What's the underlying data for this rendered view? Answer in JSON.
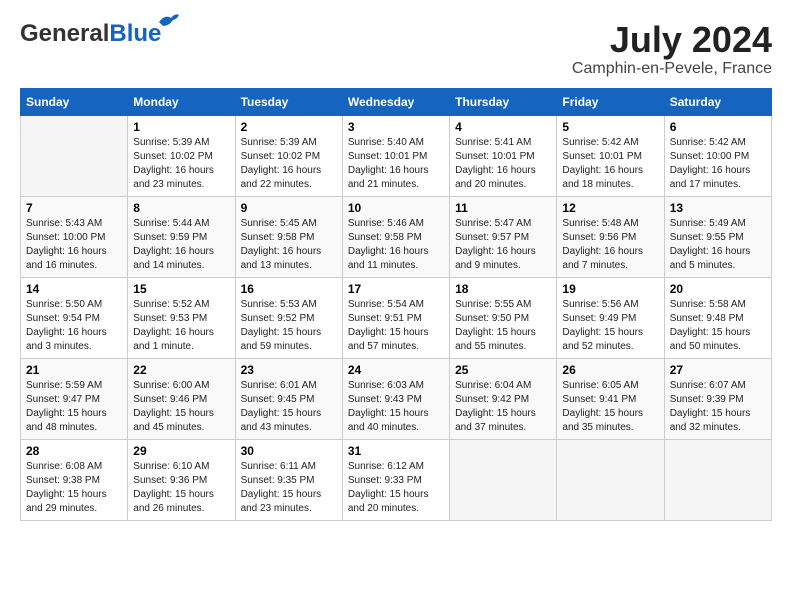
{
  "logo": {
    "general": "General",
    "blue": "Blue"
  },
  "title": {
    "month_year": "July 2024",
    "location": "Camphin-en-Pevele, France"
  },
  "days_of_week": [
    "Sunday",
    "Monday",
    "Tuesday",
    "Wednesday",
    "Thursday",
    "Friday",
    "Saturday"
  ],
  "weeks": [
    [
      {
        "day": "",
        "info": ""
      },
      {
        "day": "1",
        "info": "Sunrise: 5:39 AM\nSunset: 10:02 PM\nDaylight: 16 hours\nand 23 minutes."
      },
      {
        "day": "2",
        "info": "Sunrise: 5:39 AM\nSunset: 10:02 PM\nDaylight: 16 hours\nand 22 minutes."
      },
      {
        "day": "3",
        "info": "Sunrise: 5:40 AM\nSunset: 10:01 PM\nDaylight: 16 hours\nand 21 minutes."
      },
      {
        "day": "4",
        "info": "Sunrise: 5:41 AM\nSunset: 10:01 PM\nDaylight: 16 hours\nand 20 minutes."
      },
      {
        "day": "5",
        "info": "Sunrise: 5:42 AM\nSunset: 10:01 PM\nDaylight: 16 hours\nand 18 minutes."
      },
      {
        "day": "6",
        "info": "Sunrise: 5:42 AM\nSunset: 10:00 PM\nDaylight: 16 hours\nand 17 minutes."
      }
    ],
    [
      {
        "day": "7",
        "info": "Sunrise: 5:43 AM\nSunset: 10:00 PM\nDaylight: 16 hours\nand 16 minutes."
      },
      {
        "day": "8",
        "info": "Sunrise: 5:44 AM\nSunset: 9:59 PM\nDaylight: 16 hours\nand 14 minutes."
      },
      {
        "day": "9",
        "info": "Sunrise: 5:45 AM\nSunset: 9:58 PM\nDaylight: 16 hours\nand 13 minutes."
      },
      {
        "day": "10",
        "info": "Sunrise: 5:46 AM\nSunset: 9:58 PM\nDaylight: 16 hours\nand 11 minutes."
      },
      {
        "day": "11",
        "info": "Sunrise: 5:47 AM\nSunset: 9:57 PM\nDaylight: 16 hours\nand 9 minutes."
      },
      {
        "day": "12",
        "info": "Sunrise: 5:48 AM\nSunset: 9:56 PM\nDaylight: 16 hours\nand 7 minutes."
      },
      {
        "day": "13",
        "info": "Sunrise: 5:49 AM\nSunset: 9:55 PM\nDaylight: 16 hours\nand 5 minutes."
      }
    ],
    [
      {
        "day": "14",
        "info": "Sunrise: 5:50 AM\nSunset: 9:54 PM\nDaylight: 16 hours\nand 3 minutes."
      },
      {
        "day": "15",
        "info": "Sunrise: 5:52 AM\nSunset: 9:53 PM\nDaylight: 16 hours\nand 1 minute."
      },
      {
        "day": "16",
        "info": "Sunrise: 5:53 AM\nSunset: 9:52 PM\nDaylight: 15 hours\nand 59 minutes."
      },
      {
        "day": "17",
        "info": "Sunrise: 5:54 AM\nSunset: 9:51 PM\nDaylight: 15 hours\nand 57 minutes."
      },
      {
        "day": "18",
        "info": "Sunrise: 5:55 AM\nSunset: 9:50 PM\nDaylight: 15 hours\nand 55 minutes."
      },
      {
        "day": "19",
        "info": "Sunrise: 5:56 AM\nSunset: 9:49 PM\nDaylight: 15 hours\nand 52 minutes."
      },
      {
        "day": "20",
        "info": "Sunrise: 5:58 AM\nSunset: 9:48 PM\nDaylight: 15 hours\nand 50 minutes."
      }
    ],
    [
      {
        "day": "21",
        "info": "Sunrise: 5:59 AM\nSunset: 9:47 PM\nDaylight: 15 hours\nand 48 minutes."
      },
      {
        "day": "22",
        "info": "Sunrise: 6:00 AM\nSunset: 9:46 PM\nDaylight: 15 hours\nand 45 minutes."
      },
      {
        "day": "23",
        "info": "Sunrise: 6:01 AM\nSunset: 9:45 PM\nDaylight: 15 hours\nand 43 minutes."
      },
      {
        "day": "24",
        "info": "Sunrise: 6:03 AM\nSunset: 9:43 PM\nDaylight: 15 hours\nand 40 minutes."
      },
      {
        "day": "25",
        "info": "Sunrise: 6:04 AM\nSunset: 9:42 PM\nDaylight: 15 hours\nand 37 minutes."
      },
      {
        "day": "26",
        "info": "Sunrise: 6:05 AM\nSunset: 9:41 PM\nDaylight: 15 hours\nand 35 minutes."
      },
      {
        "day": "27",
        "info": "Sunrise: 6:07 AM\nSunset: 9:39 PM\nDaylight: 15 hours\nand 32 minutes."
      }
    ],
    [
      {
        "day": "28",
        "info": "Sunrise: 6:08 AM\nSunset: 9:38 PM\nDaylight: 15 hours\nand 29 minutes."
      },
      {
        "day": "29",
        "info": "Sunrise: 6:10 AM\nSunset: 9:36 PM\nDaylight: 15 hours\nand 26 minutes."
      },
      {
        "day": "30",
        "info": "Sunrise: 6:11 AM\nSunset: 9:35 PM\nDaylight: 15 hours\nand 23 minutes."
      },
      {
        "day": "31",
        "info": "Sunrise: 6:12 AM\nSunset: 9:33 PM\nDaylight: 15 hours\nand 20 minutes."
      },
      {
        "day": "",
        "info": ""
      },
      {
        "day": "",
        "info": ""
      },
      {
        "day": "",
        "info": ""
      }
    ]
  ]
}
